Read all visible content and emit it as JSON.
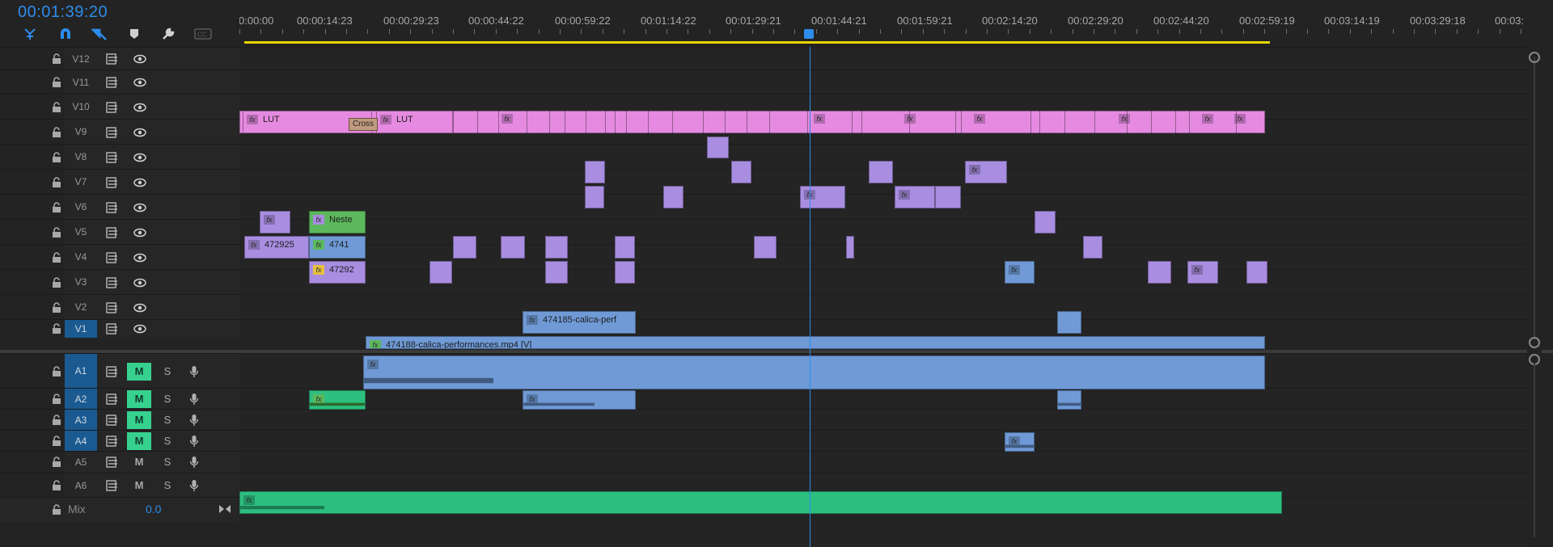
{
  "timeline": {
    "current_timecode": "00:01:39:20",
    "ruler_labels": [
      "0:00:00",
      "00:00:14:23",
      "00:00:29:23",
      "00:00:44:22",
      "00:00:59:22",
      "00:01:14:22",
      "00:01:29:21",
      "00:01:44:21",
      "00:01:59:21",
      "00:02:14:20",
      "00:02:29:20",
      "00:02:44:20",
      "00:02:59:19",
      "00:03:14:19",
      "00:03:29:18",
      "00:03:"
    ],
    "playhead_time": "00:01:39:20"
  },
  "toolbar": {
    "icons": [
      "snap-to-nested-icon",
      "magnet-snap-icon",
      "linked-selection-icon",
      "marker-icon",
      "wrench-settings-icon",
      "captions-icon"
    ]
  },
  "video_tracks": [
    {
      "name": "V12"
    },
    {
      "name": "V11"
    },
    {
      "name": "V10"
    },
    {
      "name": "V9"
    },
    {
      "name": "V8"
    },
    {
      "name": "V7"
    },
    {
      "name": "V6"
    },
    {
      "name": "V5"
    },
    {
      "name": "V4"
    },
    {
      "name": "V3"
    },
    {
      "name": "V2"
    },
    {
      "name": "V1"
    }
  ],
  "audio_tracks": [
    {
      "name": "A1",
      "mute": "M",
      "solo": "S",
      "mute_active": true
    },
    {
      "name": "A2",
      "mute": "M",
      "solo": "S",
      "mute_active": true
    },
    {
      "name": "A3",
      "mute": "M",
      "solo": "S",
      "mute_active": true
    },
    {
      "name": "A4",
      "mute": "M",
      "solo": "S",
      "mute_active": true
    },
    {
      "name": "A5",
      "mute": "M",
      "solo": "S",
      "mute_active": false
    },
    {
      "name": "A6",
      "mute": "M",
      "solo": "S",
      "mute_active": false
    }
  ],
  "mix": {
    "label": "Mix",
    "value": "0.0"
  },
  "clip_texts": {
    "fx": "fx",
    "lut1": "LUT",
    "lut2": "LUT",
    "cross": "Cross",
    "nested": "Neste",
    "v5_a": "472925",
    "v5_b": "4741",
    "v4_a": "47292",
    "v2_a": "474185-calica-perf",
    "v1_a": "474188-calica-performances.mp4 [V]"
  },
  "colors": {
    "timecode": "#2d8ceb",
    "playhead": "#2d8ceb",
    "work_area": "#e6d400",
    "adjustment_clip": "#e58ae0",
    "graphic_clip": "#a88de0",
    "video_clip": "#6f9ad6",
    "nested_clip": "#5cb85c",
    "music_audio": "#2dbf80",
    "mute_on": "#37d18f",
    "track_target": "#1a5a91"
  }
}
